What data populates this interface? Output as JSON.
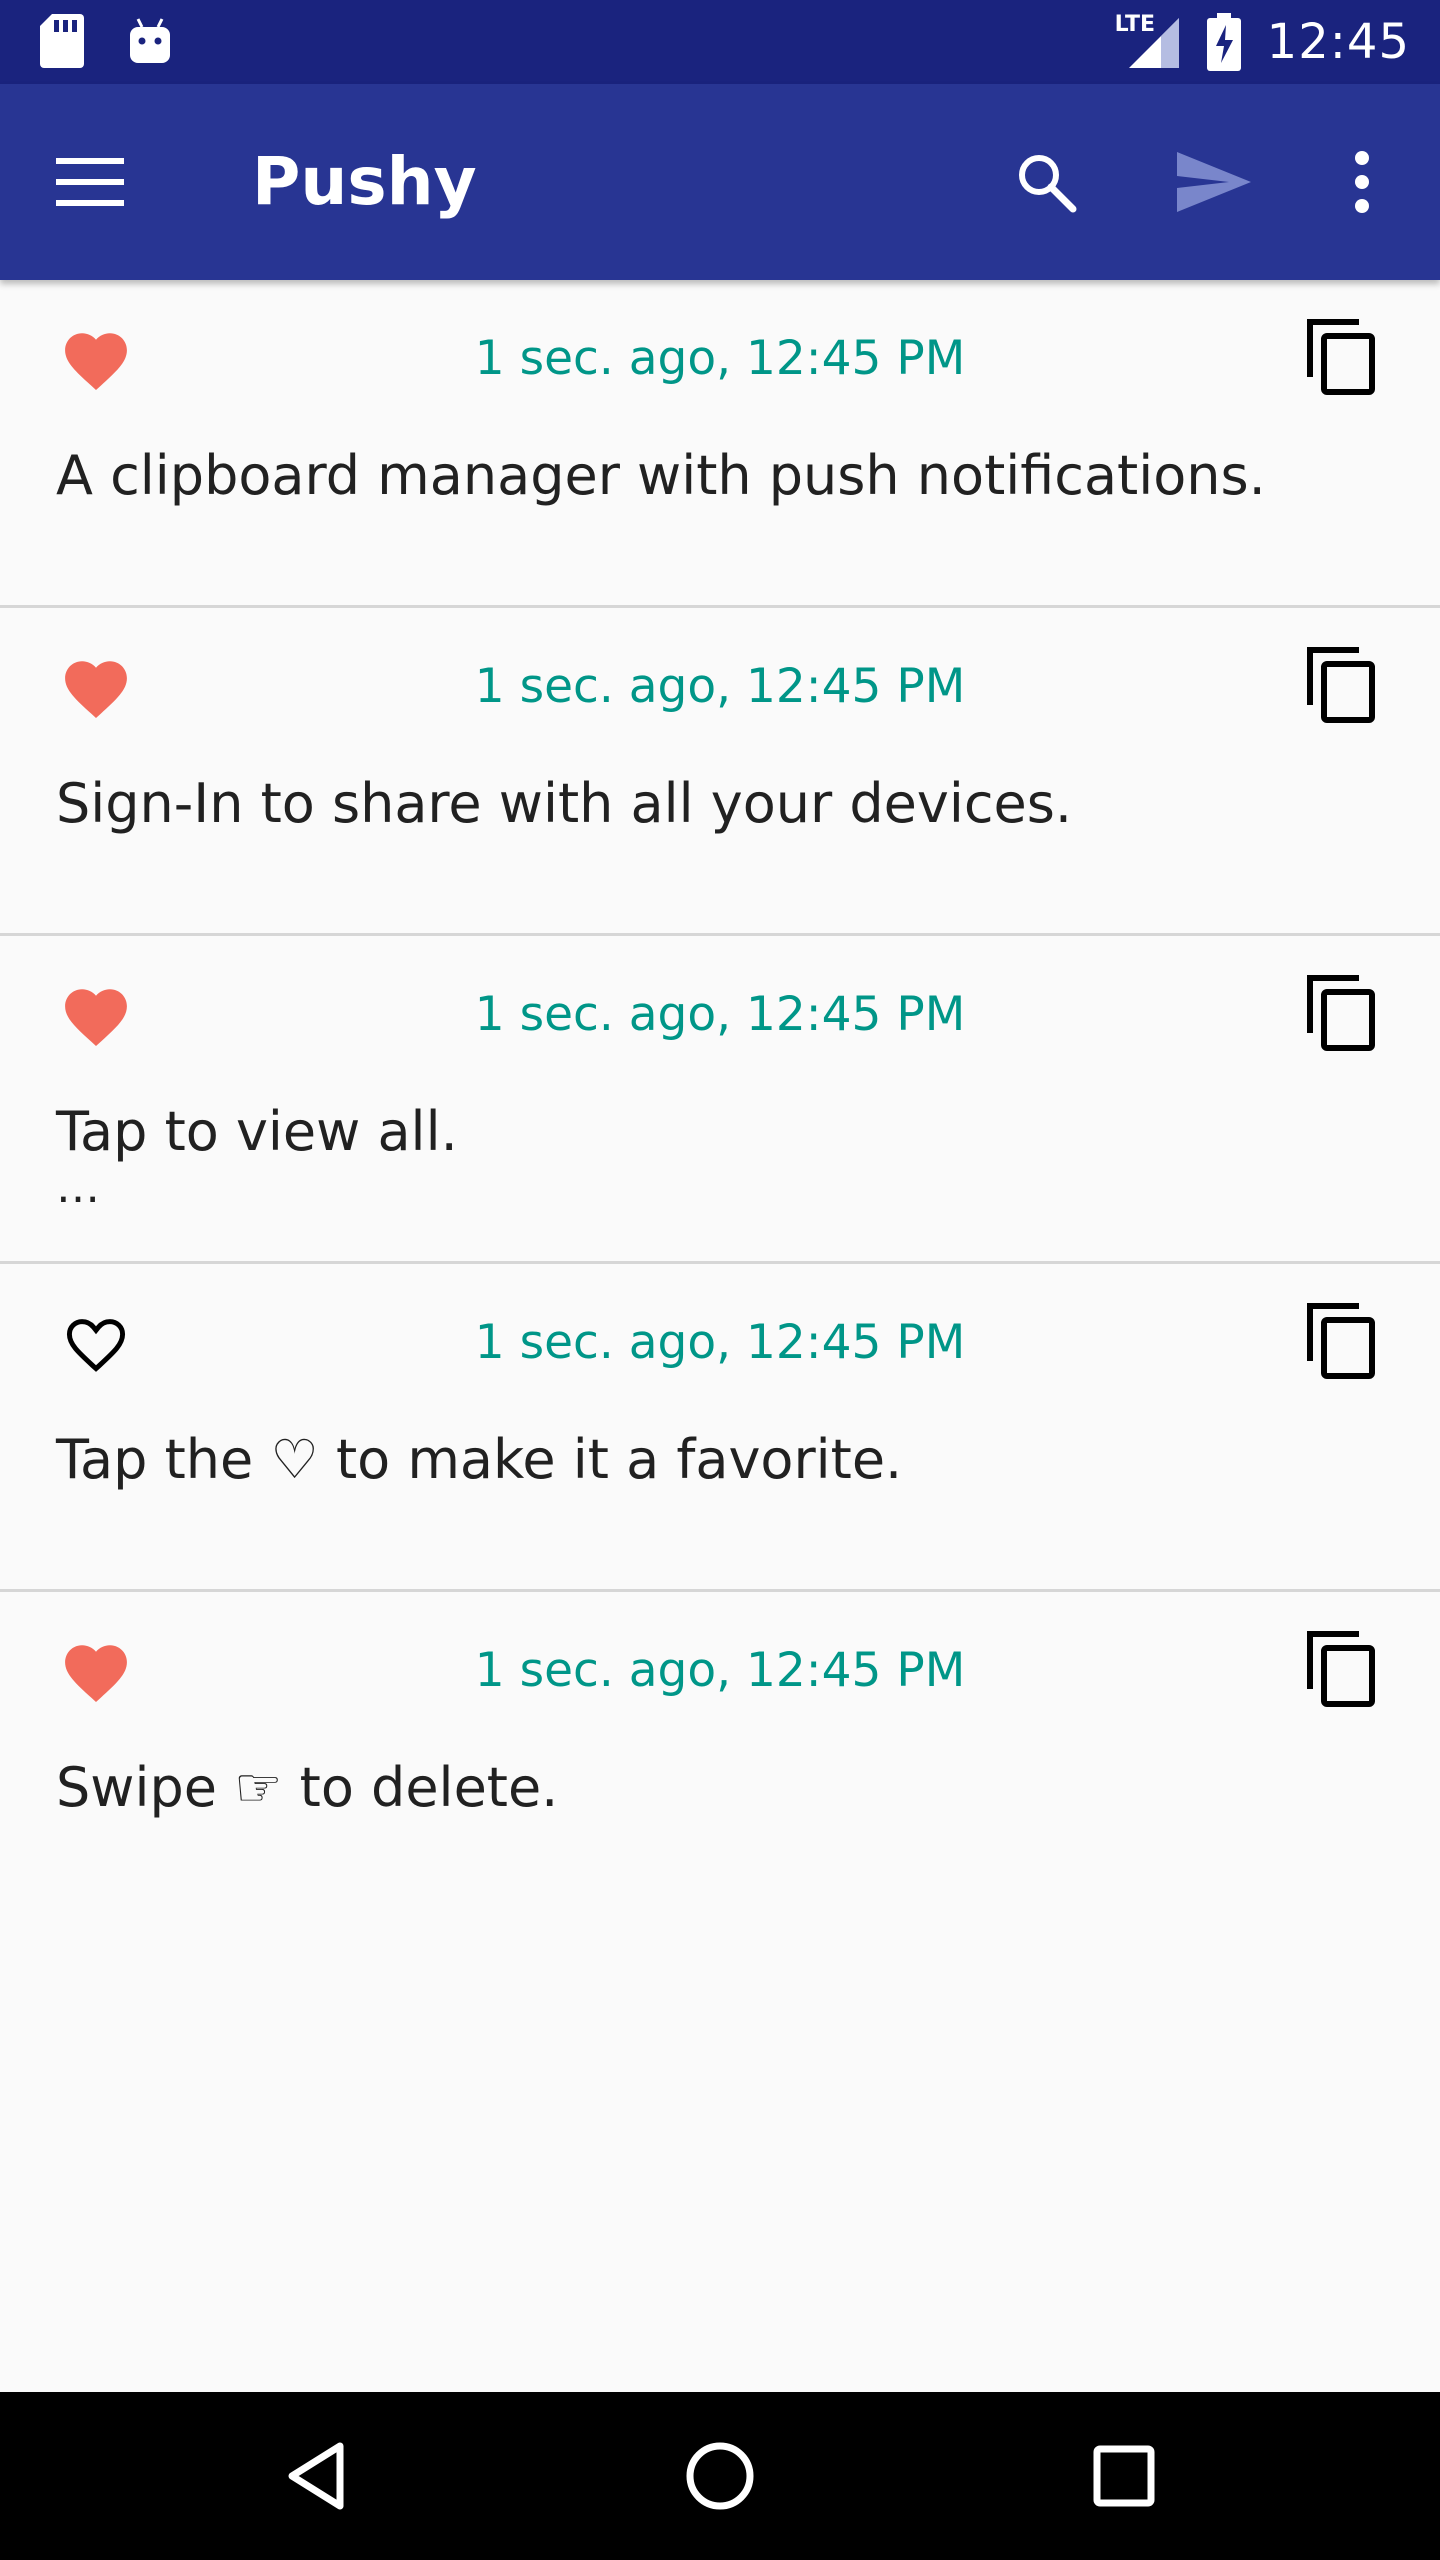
{
  "status_bar": {
    "time": "12:45",
    "network_label": "LTE",
    "icons": [
      "sd-card-icon",
      "android-icon",
      "signal-icon",
      "battery-charging-icon"
    ]
  },
  "app_bar": {
    "title": "Pushy",
    "actions": [
      "menu-icon",
      "search-icon",
      "send-icon",
      "more-vert-icon"
    ],
    "background": "#283593",
    "status_bar_background": "#1a237e"
  },
  "clips": [
    {
      "timestamp": "1 sec. ago, 12:45 PM",
      "text": "A clipboard manager with push notifications.",
      "more": "",
      "favorite": true
    },
    {
      "timestamp": "1 sec. ago, 12:45 PM",
      "text": "Sign-In to share with all your devices.",
      "more": "",
      "favorite": true
    },
    {
      "timestamp": "1 sec. ago, 12:45 PM",
      "text": "Tap to view all.",
      "more": "…",
      "favorite": true
    },
    {
      "timestamp": "1 sec. ago, 12:45 PM",
      "text": "Tap the ♡ to make it a favorite.",
      "more": "",
      "favorite": false
    },
    {
      "timestamp": "1 sec. ago, 12:45 PM",
      "text": "Swipe ☞ to delete.",
      "more": "",
      "favorite": true
    }
  ],
  "colors": {
    "timestamp": "#009688",
    "favorite": "#f26b5b",
    "text": "#212121"
  },
  "nav_bar": {
    "buttons": [
      "back-icon",
      "home-icon",
      "recents-icon"
    ]
  }
}
